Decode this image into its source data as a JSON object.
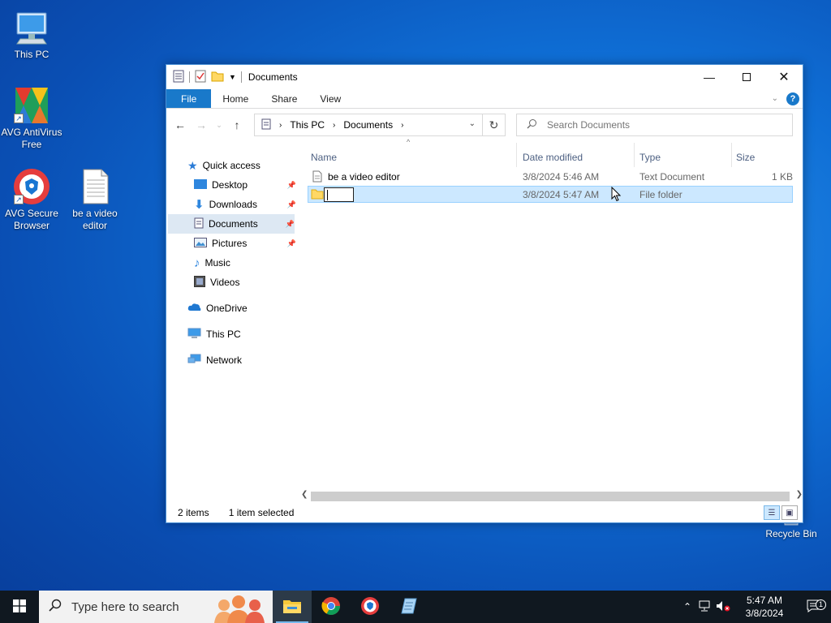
{
  "desktop": {
    "icons": [
      {
        "label": "This PC"
      },
      {
        "label": "AVG AntiVirus Free"
      },
      {
        "label": "AVG Secure Browser"
      },
      {
        "label": "be a video editor"
      },
      {
        "label": "Recycle Bin"
      }
    ]
  },
  "window": {
    "title": "Documents",
    "ribbon": {
      "file": "File",
      "home": "Home",
      "share": "Share",
      "view": "View",
      "help": "?"
    },
    "address": {
      "crumbs": [
        "This PC",
        "Documents"
      ]
    },
    "search": {
      "placeholder": "Search Documents"
    },
    "nav": {
      "quick_access": "Quick access",
      "desktop": "Desktop",
      "downloads": "Downloads",
      "documents": "Documents",
      "pictures": "Pictures",
      "music": "Music",
      "videos": "Videos",
      "onedrive": "OneDrive",
      "this_pc": "This PC",
      "network": "Network"
    },
    "columns": {
      "name": "Name",
      "date": "Date modified",
      "type": "Type",
      "size": "Size"
    },
    "rows": [
      {
        "name": "be a video editor",
        "date": "3/8/2024 5:46 AM",
        "type": "Text Document",
        "size": "1 KB"
      },
      {
        "name": "",
        "date": "3/8/2024 5:47 AM",
        "type": "File folder",
        "size": ""
      }
    ],
    "status": {
      "items": "2 items",
      "selected": "1 item selected"
    }
  },
  "taskbar": {
    "search_placeholder": "Type here to search",
    "clock_time": "5:47 AM",
    "clock_date": "3/8/2024",
    "notif_count": "1"
  },
  "colors": {
    "accent": "#1979ca",
    "selection": "#cce8ff",
    "taskbar": "#101820"
  }
}
